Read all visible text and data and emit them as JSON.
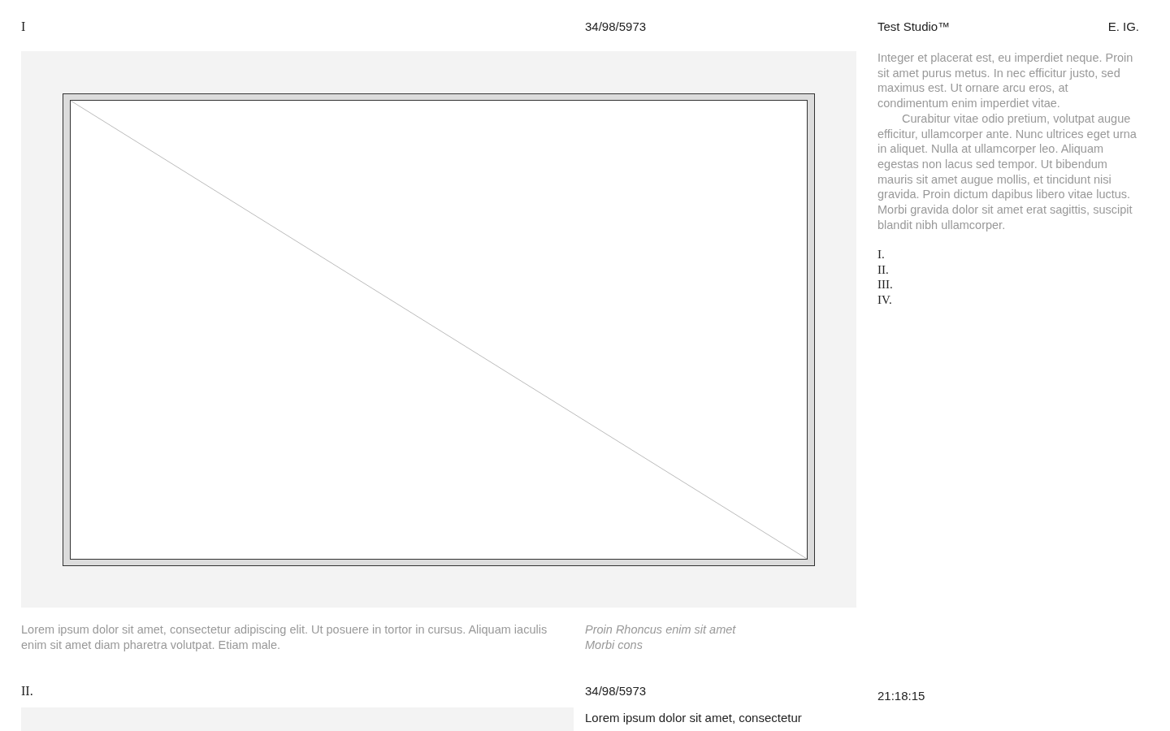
{
  "header": {
    "section": "I",
    "date": "34/98/5973",
    "studio": "Test Studio™",
    "link": "E. IG."
  },
  "figure": {
    "kind": "picture",
    "caption": "Lorem ipsum dolor sit amet, consectetur adipiscing elit. Ut posuere in tortor in cursus. Aliquam iaculis enim sit amet diam pharetra volutpat. Etiam male.",
    "note_lines": [
      "Proin Rhoncus enim sit amet",
      "Morbi cons"
    ]
  },
  "sidebar": {
    "paragraphs": [
      "Integer et placerat est, eu imperdiet neque. Proin sit amet purus metus. In nec efficitur justo, sed maximus est. Ut ornare arcu eros, at condimentum enim imperdiet vitae.",
      "Curabitur vitae odio pretium, volutpat augue efficitur, ullamcorper ante. Nunc ultrices eget urna in aliquet. Nulla at ullamcorper leo. Aliquam egestas non lacus sed tempor. Ut bibendum mauris sit amet augue mollis, et tincidunt nisi gravida. Proin dictum dapibus libero vitae luctus. Morbi gravida dolor sit amet erat sagittis, suscipit blandit nibh ullamcorper."
    ],
    "index": [
      "I.",
      "II.",
      "III.",
      "IV."
    ]
  },
  "section_2": {
    "number": "II.",
    "date": "34/98/5973",
    "time": "21:18:15",
    "text": "Lorem ipsum dolor sit amet, consectetur"
  }
}
